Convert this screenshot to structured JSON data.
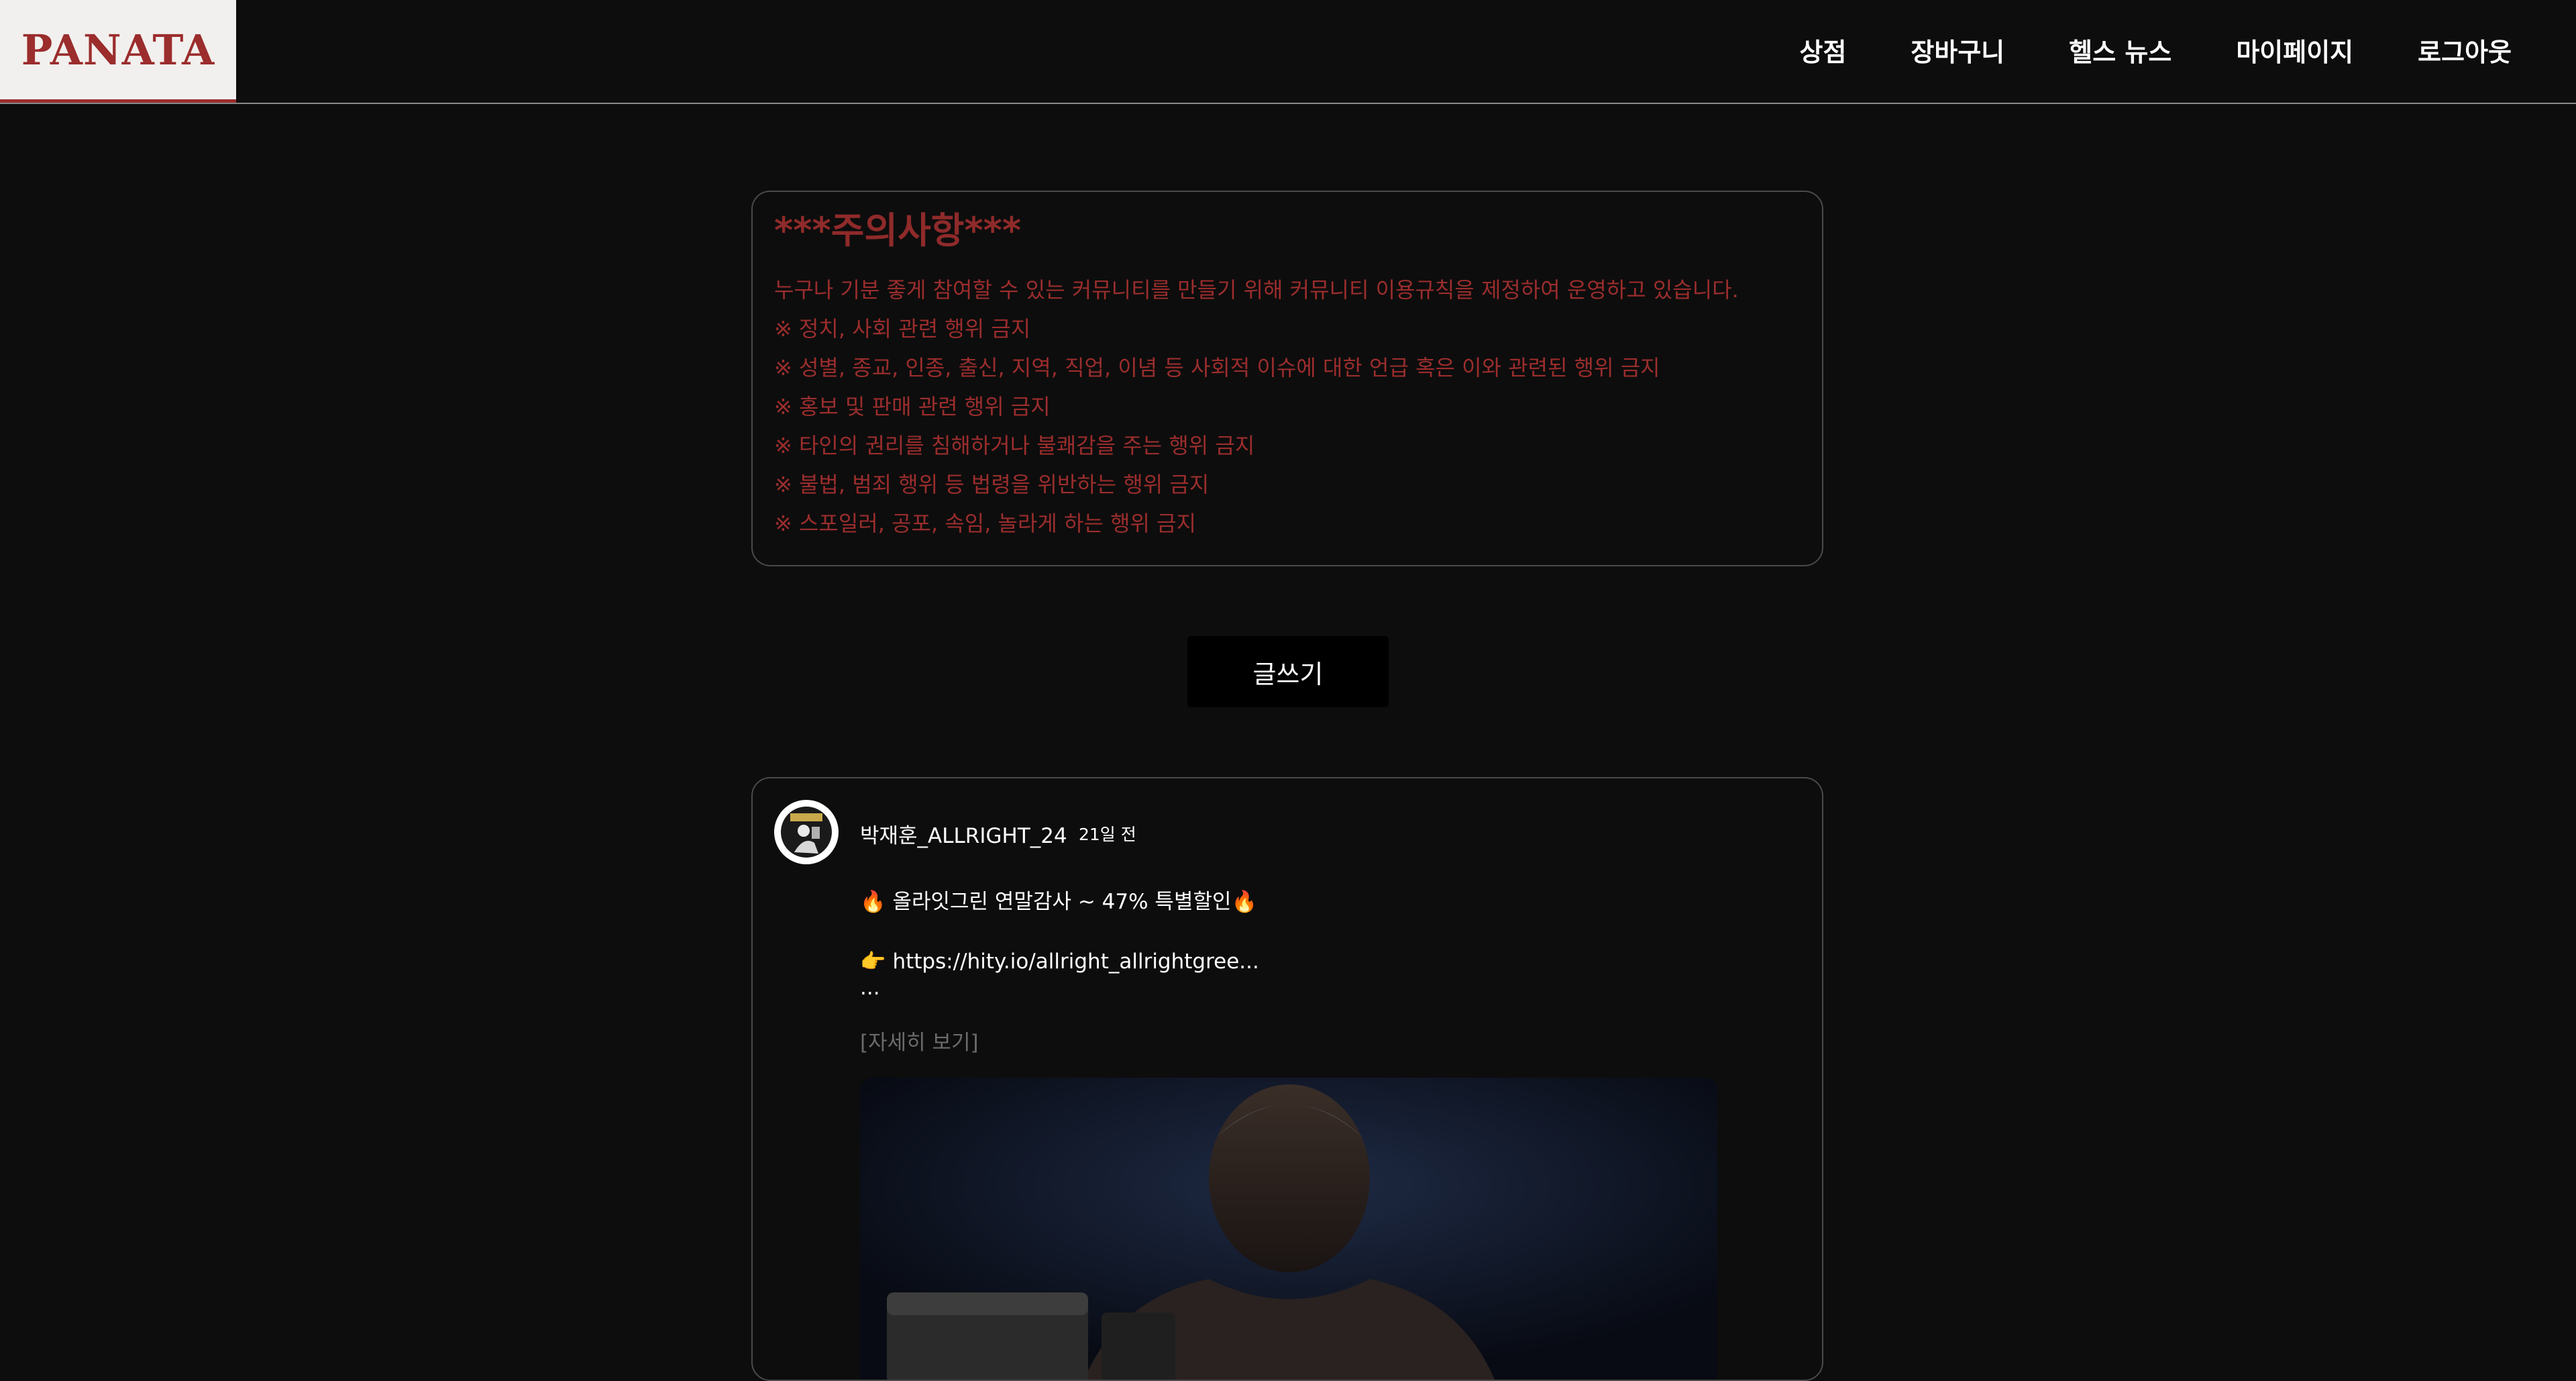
{
  "header": {
    "logo": "PANATA",
    "nav": [
      {
        "label": "상점"
      },
      {
        "label": "장바구니"
      },
      {
        "label": "헬스 뉴스"
      },
      {
        "label": "마이페이지"
      },
      {
        "label": "로그아웃"
      }
    ]
  },
  "notice": {
    "title": "***주의사항***",
    "lines": [
      "누구나 기분 좋게 참여할 수 있는 커뮤니티를 만들기 위해 커뮤니티 이용규칙을 제정하여 운영하고 있습니다.",
      "※ 정치, 사회 관련 행위 금지",
      "※ 성별, 종교, 인종, 출신, 지역, 직업, 이념 등 사회적 이슈에 대한 언급 혹은 이와 관련된 행위 금지",
      "※ 홍보 및 판매 관련 행위 금지",
      "※ 타인의 권리를 침해하거나 불쾌감을 주는 행위 금지",
      "※ 불법, 범죄 행위 등 법령을 위반하는 행위 금지",
      "※ 스포일러, 공포, 속임, 놀라게 하는 행위 금지"
    ]
  },
  "write_button": {
    "label": "글쓰기"
  },
  "post": {
    "username": "박재훈_ALLRIGHT_24",
    "time": "21일 전",
    "line1": "🔥 올라잇그린 연말감사 ~ 47% 특별할인🔥",
    "line2": "👉 https://hity.io/allright_allrightgree...",
    "line3": "...",
    "more": "[자세히 보기]"
  },
  "colors": {
    "background": "#0d0d0d",
    "accent": "#9b2d2d",
    "logo_bg": "#f2f0ee"
  }
}
